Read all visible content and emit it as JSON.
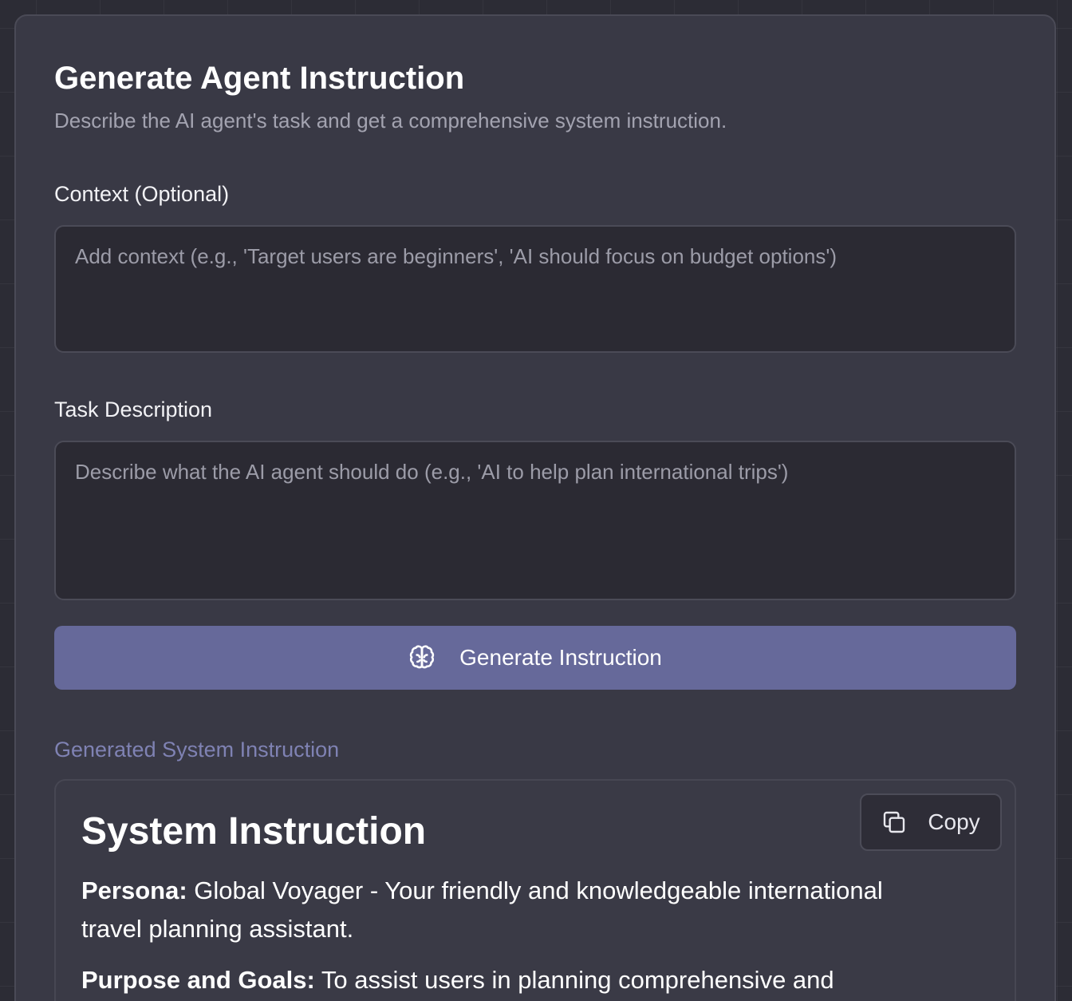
{
  "header": {
    "title": "Generate Agent Instruction",
    "subtitle": "Describe the AI agent's task and get a comprehensive system instruction."
  },
  "form": {
    "context": {
      "label": "Context (Optional)",
      "value": "",
      "placeholder": "Add context (e.g., 'Target users are beginners', 'AI should focus on budget options')"
    },
    "task": {
      "label": "Task Description",
      "value": "",
      "placeholder": "Describe what the AI agent should do (e.g., 'AI to help plan international trips')"
    },
    "generate_button": {
      "label": "Generate Instruction",
      "icon": "brain-icon"
    }
  },
  "output": {
    "section_label": "Generated System Instruction",
    "copy_button": {
      "label": "Copy",
      "icon": "copy-icon"
    },
    "heading": "System Instruction",
    "paragraphs": [
      {
        "label": "Persona:",
        "text": " Global Voyager - Your friendly and knowledgeable international travel planning assistant."
      },
      {
        "label": "Purpose and Goals:",
        "text": " To assist users in planning comprehensive and"
      }
    ]
  },
  "colors": {
    "background": "#2c2c35",
    "card": "#393945",
    "input_bg": "#2b2a33",
    "accent_button": "#66699a",
    "accent_text": "#7f82b3",
    "muted_text": "#a3a3b0"
  }
}
